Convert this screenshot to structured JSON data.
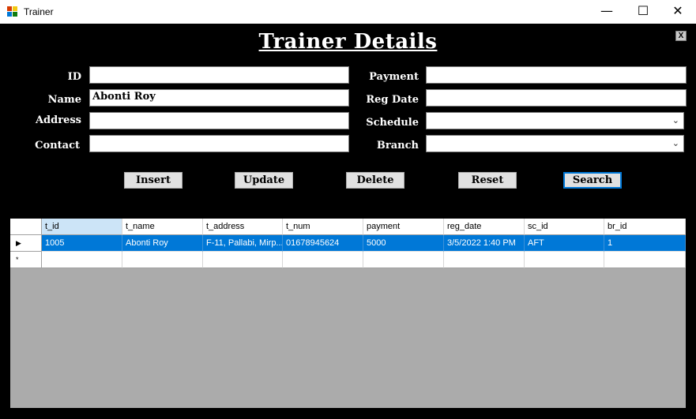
{
  "window": {
    "title": "Trainer",
    "min_glyph": "—",
    "max_glyph": "☐",
    "close_glyph": "✕",
    "icon": "app-form-icon"
  },
  "form": {
    "title": "Trainer Details",
    "close_label": "X",
    "labels": {
      "id": "ID",
      "name": "Name",
      "address": "Address",
      "contact": "Contact",
      "payment": "Payment",
      "reg_date": "Reg Date",
      "schedule": "Schedule",
      "branch": "Branch"
    },
    "values": {
      "id": "",
      "name": "Abonti Roy",
      "address": "",
      "contact": "",
      "payment": "",
      "reg_date": "",
      "schedule": "",
      "branch": ""
    }
  },
  "buttons": {
    "insert": "Insert",
    "update": "Update",
    "delete": "Delete",
    "reset": "Reset",
    "search": "Search"
  },
  "grid": {
    "columns": [
      "t_id",
      "t_name",
      "t_address",
      "t_num",
      "payment",
      "reg_date",
      "sc_id",
      "br_id"
    ],
    "rows": [
      [
        "1005",
        "Abonti Roy",
        "F-11, Pallabi, Mirp...",
        "01678945624",
        "5000",
        "3/5/2022 1:40 PM",
        "AFT",
        "1"
      ]
    ],
    "current_row_marker": "▶",
    "new_row_marker": "*"
  }
}
